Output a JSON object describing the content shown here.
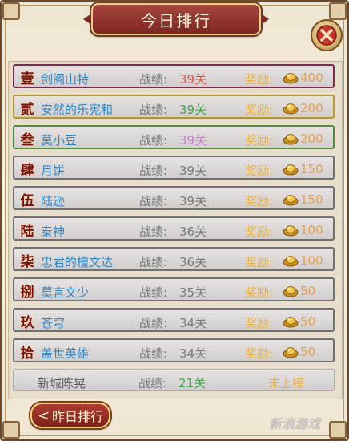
{
  "title": "今日排行",
  "score_label": "战绩:",
  "reward_label": "奖励:",
  "rows": [
    {
      "rank": "壹",
      "name": "剑阁山特",
      "score": "39关",
      "score_color": "#e0584a",
      "reward": "400",
      "border": "#7b2b53"
    },
    {
      "rank": "贰",
      "name": "安然的乐宪和",
      "score": "39关",
      "score_color": "#3ea64d",
      "reward": "200",
      "border": "#b99a24"
    },
    {
      "rank": "叁",
      "name": "莫小豆",
      "score": "39关",
      "score_color": "#d07ad8",
      "reward": "200",
      "border": "#4f8c3a"
    },
    {
      "rank": "肆",
      "name": "月饼",
      "score": "39关",
      "score_color": "#7a7a7a",
      "reward": "150",
      "border": "#707070"
    },
    {
      "rank": "伍",
      "name": "陆逊",
      "score": "39关",
      "score_color": "#7a7a7a",
      "reward": "150",
      "border": "#707070"
    },
    {
      "rank": "陆",
      "name": "泰神",
      "score": "36关",
      "score_color": "#7a7a7a",
      "reward": "100",
      "border": "#707070"
    },
    {
      "rank": "柒",
      "name": "忠君的檀文达",
      "score": "36关",
      "score_color": "#7a7a7a",
      "reward": "100",
      "border": "#707070"
    },
    {
      "rank": "捌",
      "name": "莫言文少",
      "score": "35关",
      "score_color": "#7a7a7a",
      "reward": "50",
      "border": "#707070"
    },
    {
      "rank": "玖",
      "name": "苍穹",
      "score": "34关",
      "score_color": "#7a7a7a",
      "reward": "50",
      "border": "#707070"
    },
    {
      "rank": "拾",
      "name": "盖世英雄",
      "score": "34关",
      "score_color": "#7a7a7a",
      "reward": "50",
      "border": "#707070"
    }
  ],
  "self_row": {
    "name": "新城陈晃",
    "score": "21关",
    "score_color": "#3ea64d",
    "status": "未上榜"
  },
  "yesterday_button": "昨日排行",
  "watermark": "新浪游戏"
}
